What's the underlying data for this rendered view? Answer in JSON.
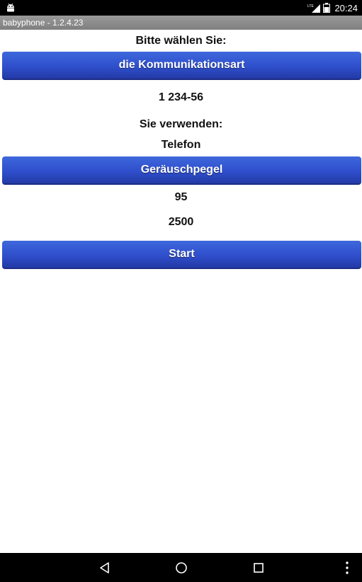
{
  "status_bar": {
    "time": "20:24",
    "network_label": "LTE",
    "icons": [
      "android-icon",
      "lte-signal-icon",
      "battery-icon"
    ]
  },
  "title_bar": {
    "title": "babyphone - 1.2.4.23"
  },
  "main": {
    "prompt": "Bitte wählen Sie:",
    "communication_button": "die Kommunikationsart",
    "phone_number": "1 234-56",
    "using_label": "Sie verwenden:",
    "using_value": "Telefon",
    "noise_level_button": "Geräuschpegel",
    "noise_level_value": "95",
    "delay_value": "2500",
    "start_button": "Start"
  },
  "nav_bar": {
    "icons": [
      "back-icon",
      "home-icon",
      "recents-icon",
      "more-options-icon"
    ]
  },
  "colors": {
    "button_top": "#3f68dc",
    "button_bottom": "#233aa6",
    "status_bar": "#000000",
    "title_bar": "#8c8c8c"
  }
}
